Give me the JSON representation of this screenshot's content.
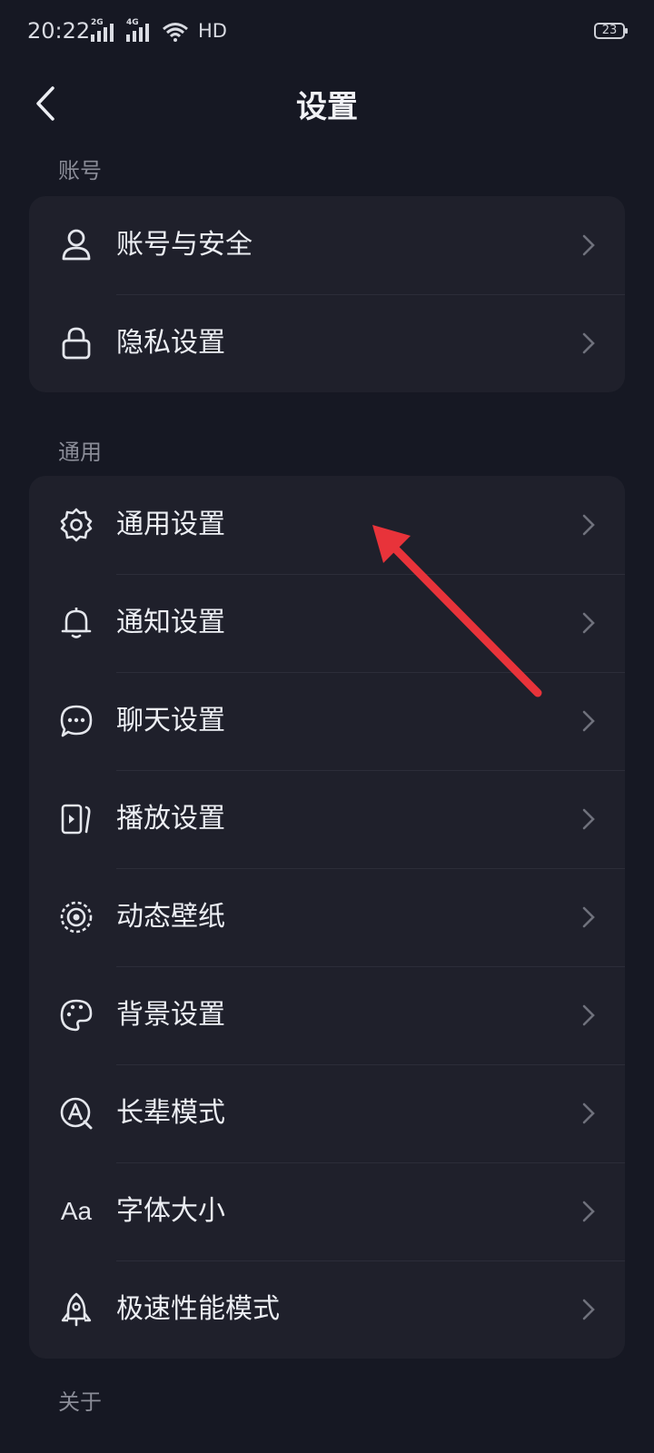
{
  "status_bar": {
    "time": "20:22",
    "network1": "2G",
    "network2": "4G",
    "hd": "HD",
    "battery": "23"
  },
  "header": {
    "title": "设置",
    "back_icon": "chevron-left-icon"
  },
  "sections": {
    "account": {
      "label": "账号",
      "items": [
        {
          "label": "账号与安全",
          "icon": "user-icon"
        },
        {
          "label": "隐私设置",
          "icon": "lock-icon"
        }
      ]
    },
    "general": {
      "label": "通用",
      "items": [
        {
          "label": "通用设置",
          "icon": "gear-icon"
        },
        {
          "label": "通知设置",
          "icon": "bell-icon"
        },
        {
          "label": "聊天设置",
          "icon": "chat-icon"
        },
        {
          "label": "播放设置",
          "icon": "play-icon"
        },
        {
          "label": "动态壁纸",
          "icon": "wallpaper-icon"
        },
        {
          "label": "背景设置",
          "icon": "palette-icon"
        },
        {
          "label": "长辈模式",
          "icon": "elder-mode-icon"
        },
        {
          "label": "字体大小",
          "icon": "font-size-icon",
          "icon_text": "Aa"
        },
        {
          "label": "极速性能模式",
          "icon": "rocket-icon"
        }
      ]
    },
    "about": {
      "label": "关于"
    }
  },
  "colors": {
    "background": "#161823",
    "card": "#1f202b",
    "annotation_arrow": "#e8333a"
  }
}
